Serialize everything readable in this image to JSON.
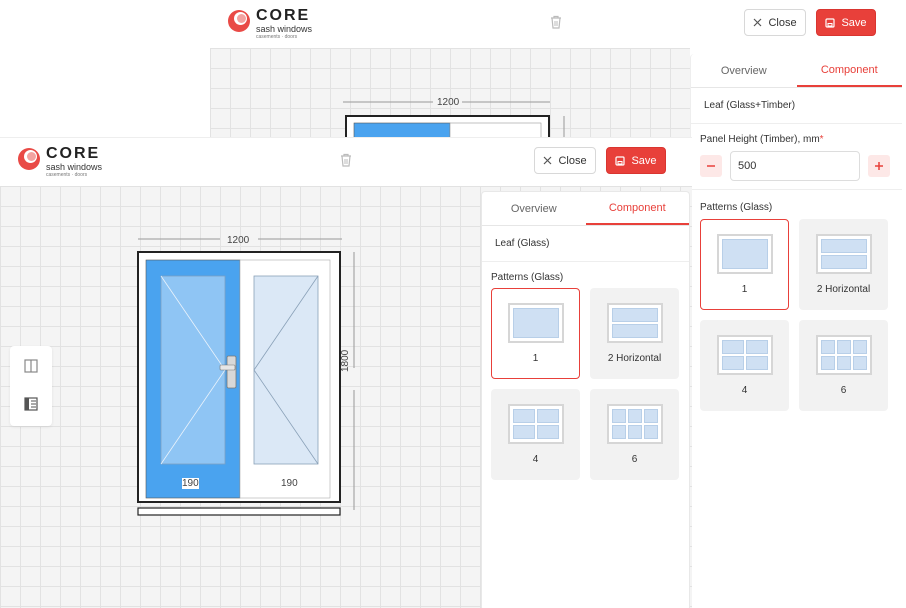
{
  "app": {
    "logo_word": "CORE",
    "logo_tagline": "sash windows",
    "logo_subline": "casements · doors"
  },
  "toolbar": {
    "close_label": "Close",
    "save_label": "Save"
  },
  "back_panel": {
    "tabs": [
      {
        "label": "Overview"
      },
      {
        "label": "Component"
      }
    ],
    "active_tab": "Component",
    "section_title": "Leaf (Glass+Timber)",
    "panel_height_label": "Panel Height (Timber), mm",
    "panel_height_required": "*",
    "panel_height_value": "500",
    "patterns_label": "Patterns (Glass)",
    "patterns": [
      {
        "label": "1"
      },
      {
        "label": "2 Horizontal"
      },
      {
        "label": "4"
      },
      {
        "label": "6"
      }
    ],
    "selected_pattern": "1"
  },
  "front_panel": {
    "tabs": [
      {
        "label": "Overview"
      },
      {
        "label": "Component"
      }
    ],
    "active_tab": "Component",
    "section_title": "Leaf (Glass)",
    "patterns_label": "Patterns (Glass)",
    "patterns": [
      {
        "label": "1"
      },
      {
        "label": "2 Horizontal"
      },
      {
        "label": "4"
      },
      {
        "label": "6"
      }
    ],
    "selected_pattern": "1"
  },
  "canvas": {
    "width_label": "1200",
    "height_label": "1800",
    "leaf_left_label": "190",
    "leaf_right_label": "190"
  },
  "colors": {
    "accent": "#e8403a",
    "selected_leaf": "#4aa3ef",
    "glass": "#cfe0f3"
  },
  "icons": [
    "trash-icon",
    "close-icon",
    "save-icon",
    "minus-icon",
    "plus-icon",
    "split-view-icon",
    "list-view-icon"
  ]
}
